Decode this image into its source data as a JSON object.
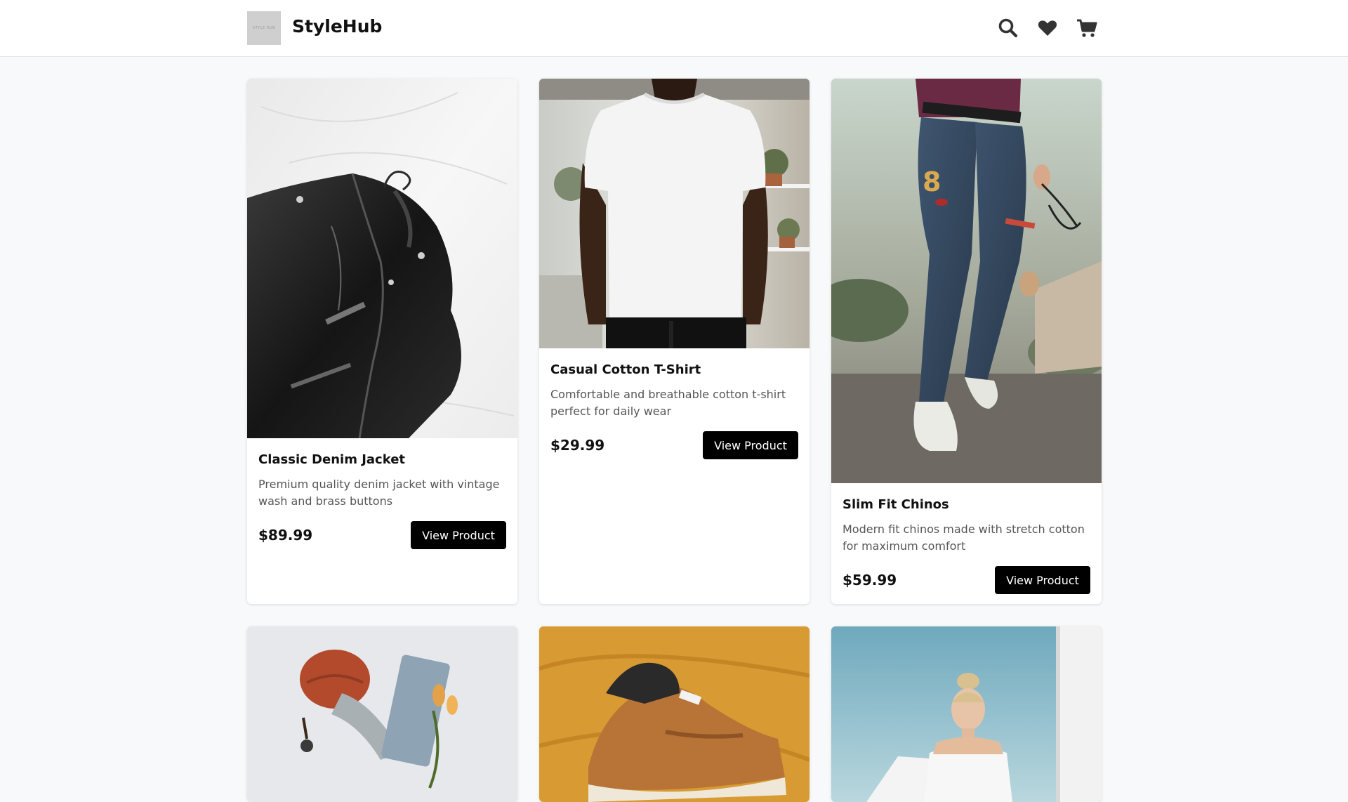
{
  "header": {
    "logo_text": "STYLE HUB",
    "brand": "StyleHub",
    "icons": [
      "search-icon",
      "heart-icon",
      "cart-icon"
    ]
  },
  "products": [
    {
      "title": "Classic Denim Jacket",
      "description": "Premium quality denim jacket with vintage wash and brass buttons",
      "price": "$89.99",
      "button": "View Product"
    },
    {
      "title": "Casual Cotton T-Shirt",
      "description": "Comfortable and breathable cotton t-shirt perfect for daily wear",
      "price": "$29.99",
      "button": "View Product"
    },
    {
      "title": "Slim Fit Chinos",
      "description": "Modern fit chinos made with stretch cotton for maximum comfort",
      "price": "$59.99",
      "button": "View Product"
    }
  ],
  "colors": {
    "background": "#f8f9fa",
    "button": "#000000",
    "card": "#ffffff"
  }
}
